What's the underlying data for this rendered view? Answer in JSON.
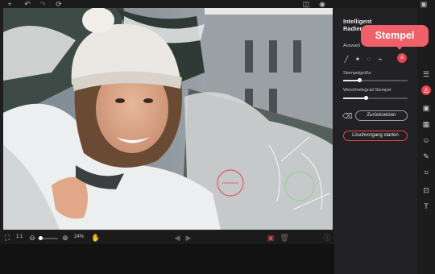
{
  "toolbar": {
    "add_icon": "+",
    "undo_icon": "↶",
    "redo_icon": "↷",
    "refresh_icon": "⟳",
    "compare_icon": "◫",
    "eye_icon": "◉",
    "save_icon": "💾"
  },
  "panel": {
    "title": "Intelligent\nRadierer",
    "selection_label": "Auswahl",
    "stamp_size_label": "Stempelgröße",
    "stamp_size_value": 0.25,
    "softness_label": "Weichheitsgrad Stempel",
    "softness_value": 0.35,
    "reset_button": "Zurücksetzen",
    "start_button": "Löschvorgang starten",
    "accent": "#e8424f"
  },
  "tooltip": {
    "text": "Stempel"
  },
  "bottombar": {
    "ratio_label": "1:1",
    "zoom_value": "24%",
    "zoom_level": 0.24
  },
  "rail": {
    "icons": [
      "sliders-icon",
      "stamp-icon",
      "image-icon",
      "brush-icon",
      "face-icon",
      "pen-icon",
      "crop-icon",
      "transform-icon",
      "text-icon"
    ]
  }
}
